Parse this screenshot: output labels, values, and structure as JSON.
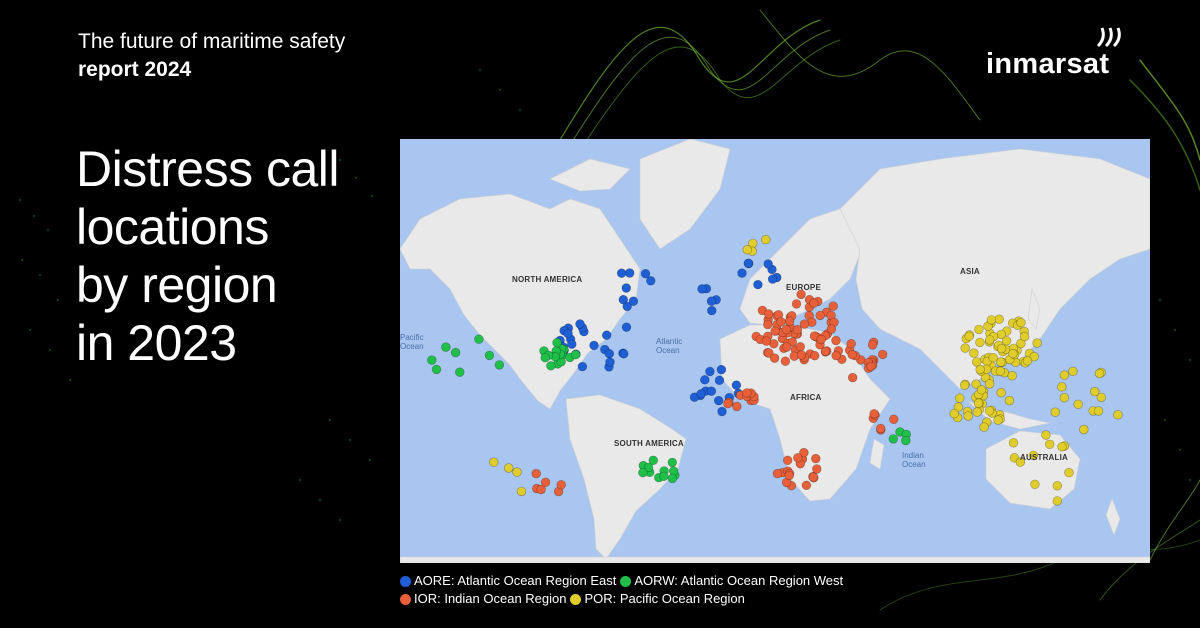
{
  "header": {
    "eyebrow_line1": "The future of maritime safety",
    "eyebrow_line2": "report 2024"
  },
  "headline": {
    "line1": "Distress call",
    "line2": "locations",
    "line3": "by region",
    "line4": "in 2023"
  },
  "brand": {
    "name": "inmarsat"
  },
  "map": {
    "labels": {
      "north_america": "NORTH AMERICA",
      "south_america": "SOUTH AMERICA",
      "europe": "EUROPE",
      "africa": "AFRICA",
      "asia": "ASIA",
      "australia": "AUSTRALIA",
      "pacific": "Pacific Ocean",
      "atlantic": "Atlantic Ocean",
      "indian": "Indian Ocean"
    }
  },
  "legend": [
    {
      "code": "AORE",
      "label": "AORE: Atlantic Ocean Region East",
      "color": "#1f5fd6"
    },
    {
      "code": "AORW",
      "label": "AORW: Atlantic Ocean Region West",
      "color": "#1fbf4a"
    },
    {
      "code": "IOR",
      "label": "IOR: Indian Ocean Region",
      "color": "#e8603a"
    },
    {
      "code": "POR",
      "label": "POR: Pacific Ocean Region",
      "color": "#e0cc2a"
    }
  ],
  "colors": {
    "ocean": "#a9c6f0",
    "land": "#e9e9e9",
    "background": "#000000",
    "wave_green": "#8ee03a"
  }
}
